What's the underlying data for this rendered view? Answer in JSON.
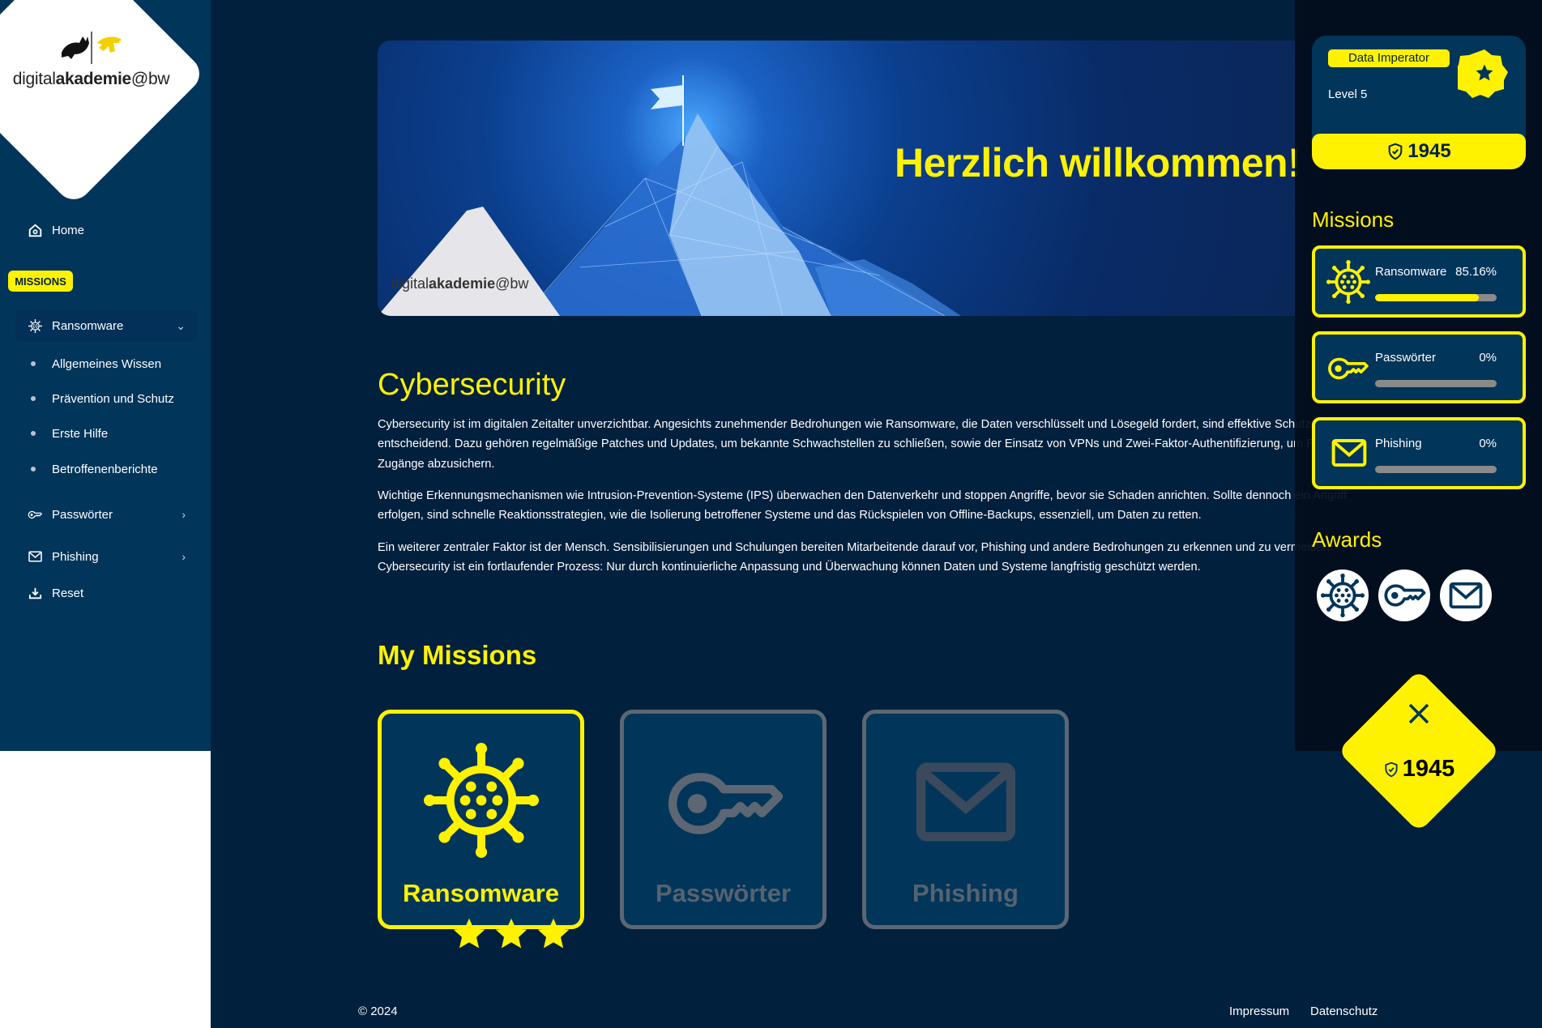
{
  "sidebar": {
    "logo": {
      "prefix": "digital",
      "bold": "akademie",
      "suffix": "@bw"
    },
    "home_label": "Home",
    "missions_badge": "MISSIONS",
    "items": [
      {
        "label": "Ransomware",
        "icon": "virus-icon",
        "expanded": true,
        "children": [
          "Allgemeines Wissen",
          "Prävention und Schutz",
          "Erste Hilfe",
          "Betroffenenberichte"
        ]
      },
      {
        "label": "Passwörter",
        "icon": "key-icon",
        "expanded": false
      },
      {
        "label": "Phishing",
        "icon": "mail-icon",
        "expanded": false
      }
    ],
    "reset_label": "Reset"
  },
  "banner": {
    "title": "Herzlich willkommen!",
    "logo": {
      "prefix": "digital",
      "bold": "akademie",
      "suffix": "@bw"
    }
  },
  "intro": {
    "title": "Cybersecurity",
    "paragraphs": [
      "Cybersecurity ist im digitalen Zeitalter unverzichtbar. Angesichts zunehmender Bedrohungen wie Ransomware, die Daten verschlüsselt und Lösegeld fordert, sind effektive Schutzmaßnahmen entscheidend. Dazu gehören regelmäßige Patches und Updates, um bekannte Schwachstellen zu schließen, sowie der Einsatz von VPNs und Zwei-Faktor-Authentifizierung, um Remote-Zugänge abzusichern.",
      "Wichtige Erkennungsmechanismen wie Intrusion-Prevention-Systeme (IPS) überwachen den Datenverkehr und stoppen Angriffe, bevor sie Schaden anrichten. Sollte dennoch ein Angriff erfolgen, sind schnelle Reaktionsstrategien, wie die Isolierung betroffener Systeme und das Rückspielen von Offline-Backups, essenziell, um Daten zu retten.",
      "Ein weiterer zentraler Faktor ist der Mensch. Sensibilisierungen und Schulungen bereiten Mitarbeitende darauf vor, Phishing und andere Bedrohungen zu erkennen und zu vermeiden. Cybersecurity ist ein fortlaufender Prozess: Nur durch kontinuierliche Anpassung und Überwachung können Daten und Systeme langfristig geschützt werden."
    ]
  },
  "my_missions": {
    "title": "My Missions",
    "cards": [
      {
        "label": "Ransomware",
        "icon": "virus-icon",
        "completed": true,
        "stars": 3
      },
      {
        "label": "Passwörter",
        "icon": "key-icon",
        "completed": false,
        "stars": 0
      },
      {
        "label": "Phishing",
        "icon": "mail-icon",
        "completed": false,
        "stars": 0
      }
    ]
  },
  "footer": {
    "copyright": "© 2024",
    "links": [
      "Impressum",
      "Datenschutz"
    ]
  },
  "profile": {
    "rank": "Data Imperator",
    "level": "Level 5",
    "points": "1945",
    "badge_icon": "star-badge-icon",
    "points_icon": "shield-check-icon"
  },
  "panel": {
    "missions_title": "Missions",
    "missions": [
      {
        "name": "Ransomware",
        "percent_label": "85.16%",
        "progress": 85.16,
        "icon": "virus-icon"
      },
      {
        "name": "Passwörter",
        "percent_label": "0%",
        "progress": 0,
        "icon": "key-icon"
      },
      {
        "name": "Phishing",
        "percent_label": "0%",
        "progress": 0,
        "icon": "mail-icon"
      }
    ],
    "awards_title": "Awards",
    "awards": [
      "virus-icon",
      "key-icon",
      "mail-icon"
    ]
  },
  "score_widget": {
    "points": "1945",
    "close_icon": "close-icon"
  },
  "colors": {
    "accent": "#fff200",
    "sidebar": "#02355a",
    "background": "#01203d",
    "panel": "#020d1c",
    "inactive": "#5c6773"
  }
}
